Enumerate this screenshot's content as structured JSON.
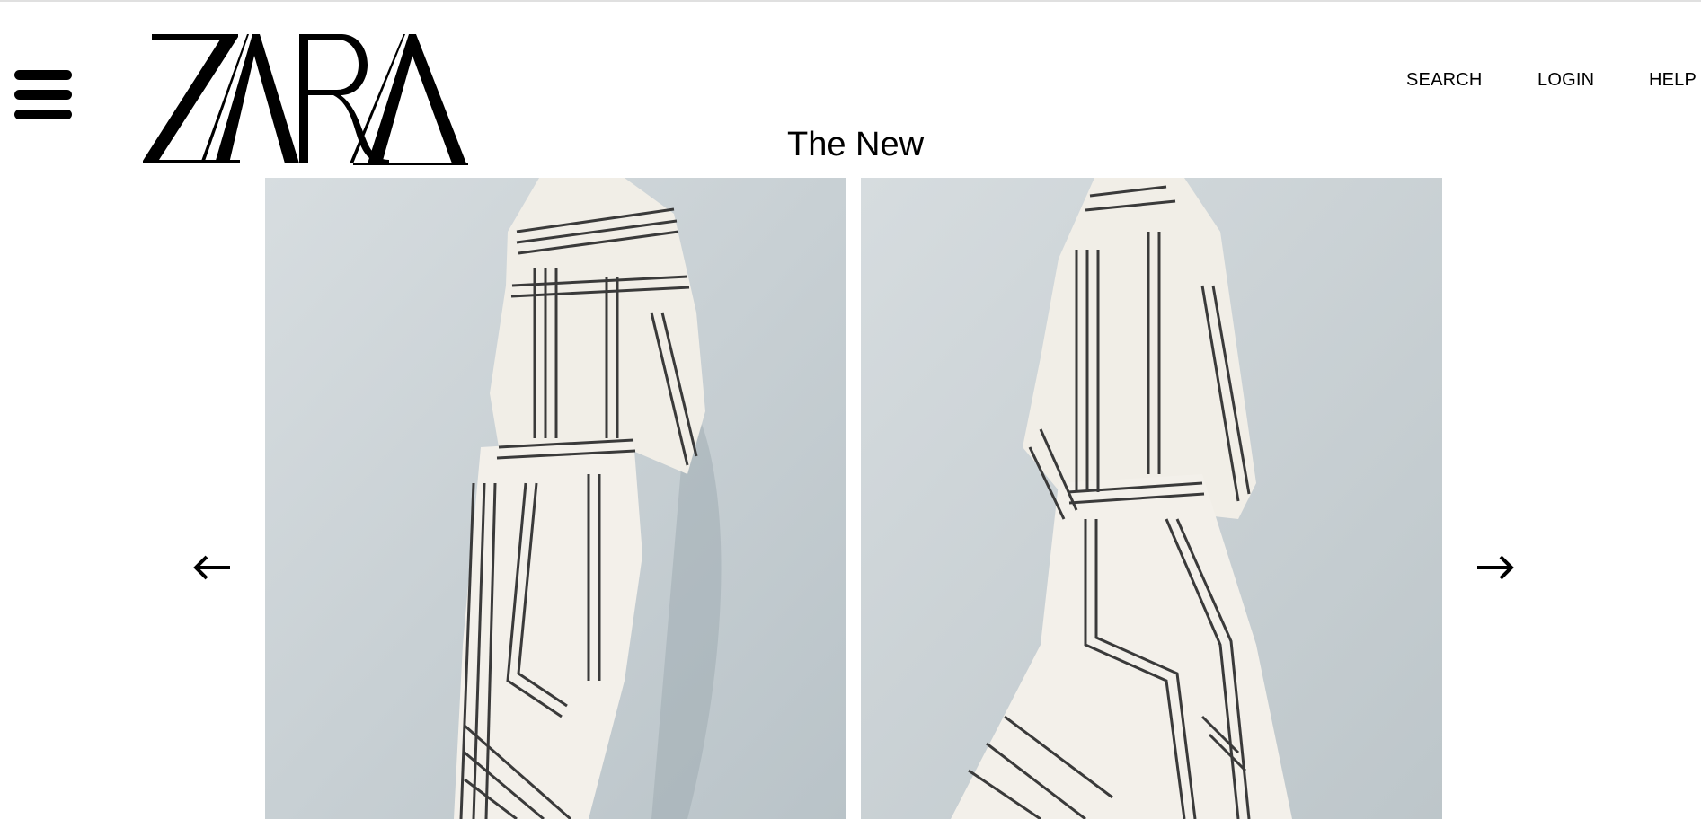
{
  "header": {
    "brand": "ZARA",
    "menu_icon": "hamburger-menu-icon",
    "nav": {
      "search_label": "SEARCH",
      "login_label": "LOGIN",
      "help_label": "HELP"
    }
  },
  "carousel": {
    "title": "The New",
    "prev_icon": "arrow-left-icon",
    "next_icon": "arrow-right-icon",
    "slides": [
      {
        "name": "slide-1",
        "description_icon": "model-photo-front"
      },
      {
        "name": "slide-2",
        "description_icon": "model-photo-side"
      }
    ]
  },
  "colors": {
    "text": "#000000",
    "background": "#ffffff",
    "photo_wall": "#c9d1d6",
    "garment": "#f2efe8",
    "stripe": "#333333"
  }
}
